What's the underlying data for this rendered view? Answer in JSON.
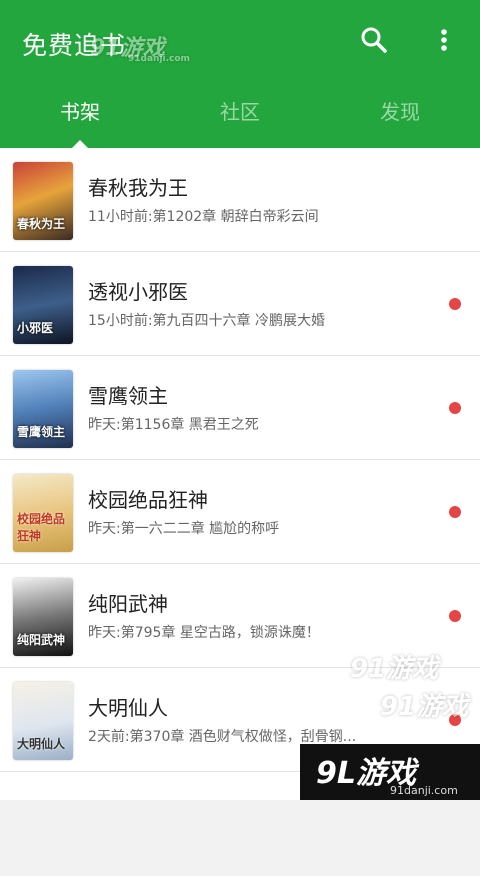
{
  "app": {
    "title": "免费追书"
  },
  "toolbar": {
    "search_icon": "search-icon",
    "more_icon": "more-vertical-icon"
  },
  "tabs": [
    {
      "label": "书架",
      "active": true
    },
    {
      "label": "社区",
      "active": false
    },
    {
      "label": "发现",
      "active": false
    }
  ],
  "books": [
    {
      "title": "春秋我为王",
      "update": "11小时前:第1202章 朝辞白帝彩云间",
      "unread": false,
      "cover_text": "春秋为王"
    },
    {
      "title": "透视小邪医",
      "update": "15小时前:第九百四十六章 冷鹏展大婚",
      "unread": true,
      "cover_text": "小邪医"
    },
    {
      "title": "雪鹰领主",
      "update": "昨天:第1156章 黑君王之死",
      "unread": true,
      "cover_text": "雪鹰领主"
    },
    {
      "title": "校园绝品狂神",
      "update": "昨天:第一六二二章 尴尬的称呼",
      "unread": true,
      "cover_text": "校园绝品狂神"
    },
    {
      "title": "纯阳武神",
      "update": "昨天:第795章 星空古路，锁源诛魔！",
      "unread": true,
      "cover_text": "纯阳武神"
    },
    {
      "title": "大明仙人",
      "update": "2天前:第370章 酒色财气权做怪，刮骨钢...",
      "unread": true,
      "cover_text": "大明仙人"
    }
  ],
  "watermark": {
    "top_logo": "91游戏",
    "top_url": "91danji.com",
    "corner_logo": "9L游戏",
    "corner_url": "91danji.com"
  },
  "colors": {
    "primary": "#23a63d",
    "unread_dot": "#e64545"
  }
}
